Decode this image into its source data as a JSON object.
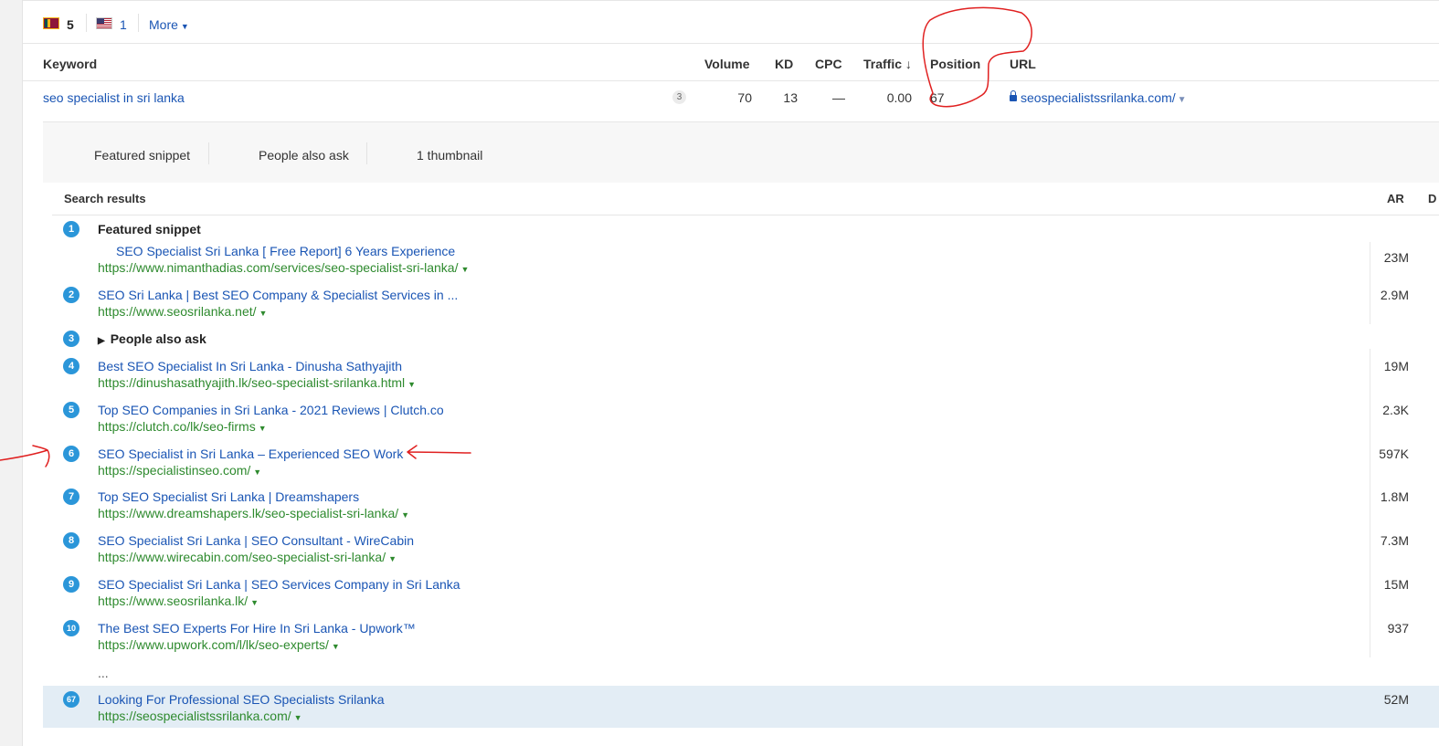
{
  "countries": {
    "lk": {
      "count": "5"
    },
    "us": {
      "count": "1"
    },
    "more_label": "More"
  },
  "keyword_table": {
    "headers": {
      "keyword": "Keyword",
      "volume": "Volume",
      "kd": "KD",
      "cpc": "CPC",
      "traffic": "Traffic ↓",
      "position": "Position",
      "url": "URL"
    },
    "row": {
      "keyword": "seo specialist in sri lanka",
      "serp_features": "3",
      "volume": "70",
      "kd": "13",
      "cpc": "—",
      "traffic": "0.00",
      "position": "67",
      "url": "seospecialistssrilanka.com/"
    }
  },
  "serp_features": [
    "Featured snippet",
    "People also ask",
    "1 thumbnail"
  ],
  "results_header": {
    "title": "Search results",
    "ar": "AR",
    "d": "D"
  },
  "featured_snippet_label": "Featured snippet",
  "people_also_ask_label": "People also ask",
  "ellipsis": "...",
  "results": [
    {
      "pos": "1",
      "title": "SEO Specialist Sri Lanka [ Free Report] 6 Years Experience",
      "url": "https://www.nimanthadias.com/services/seo-specialist-sri-lanka/",
      "ar": "23M"
    },
    {
      "pos": "2",
      "title": "SEO Sri Lanka | Best SEO Company & Specialist Services in ...",
      "url": "https://www.seosrilanka.net/",
      "ar": "2.9M"
    },
    {
      "pos": "3"
    },
    {
      "pos": "4",
      "title": "Best SEO Specialist In Sri Lanka - Dinusha Sathyajith",
      "url": "https://dinushasathyajith.lk/seo-specialist-srilanka.html",
      "ar": "19M"
    },
    {
      "pos": "5",
      "title": "Top SEO Companies in Sri Lanka - 2021 Reviews | Clutch.co",
      "url": "https://clutch.co/lk/seo-firms",
      "ar": "2.3K"
    },
    {
      "pos": "6",
      "title": "SEO Specialist in Sri Lanka – Experienced SEO Work",
      "url": "https://specialistinseo.com/",
      "ar": "597K"
    },
    {
      "pos": "7",
      "title": "Top SEO Specialist Sri Lanka | Dreamshapers",
      "url": "https://www.dreamshapers.lk/seo-specialist-sri-lanka/",
      "ar": "1.8M"
    },
    {
      "pos": "8",
      "title": "SEO Specialist Sri Lanka | SEO Consultant - WireCabin",
      "url": "https://www.wirecabin.com/seo-specialist-sri-lanka/",
      "ar": "7.3M"
    },
    {
      "pos": "9",
      "title": "SEO Specialist Sri Lanka | SEO Services Company in Sri Lanka",
      "url": "https://www.seosrilanka.lk/",
      "ar": "15M"
    },
    {
      "pos": "10",
      "title": "The Best SEO Experts For Hire In Sri Lanka - Upwork™",
      "url": "https://www.upwork.com/l/lk/seo-experts/",
      "ar": "937"
    },
    {
      "pos": "67",
      "title": "Looking For Professional SEO Specialists Srilanka",
      "url": "https://seospecialistssrilanka.com/",
      "ar": "52M"
    }
  ],
  "colors": {
    "link": "#1a55b4",
    "url_green": "#2e8a2e",
    "position_badge": "#2b96d9",
    "highlight_row": "#e3edf5",
    "annotation_red": "#e02020"
  }
}
